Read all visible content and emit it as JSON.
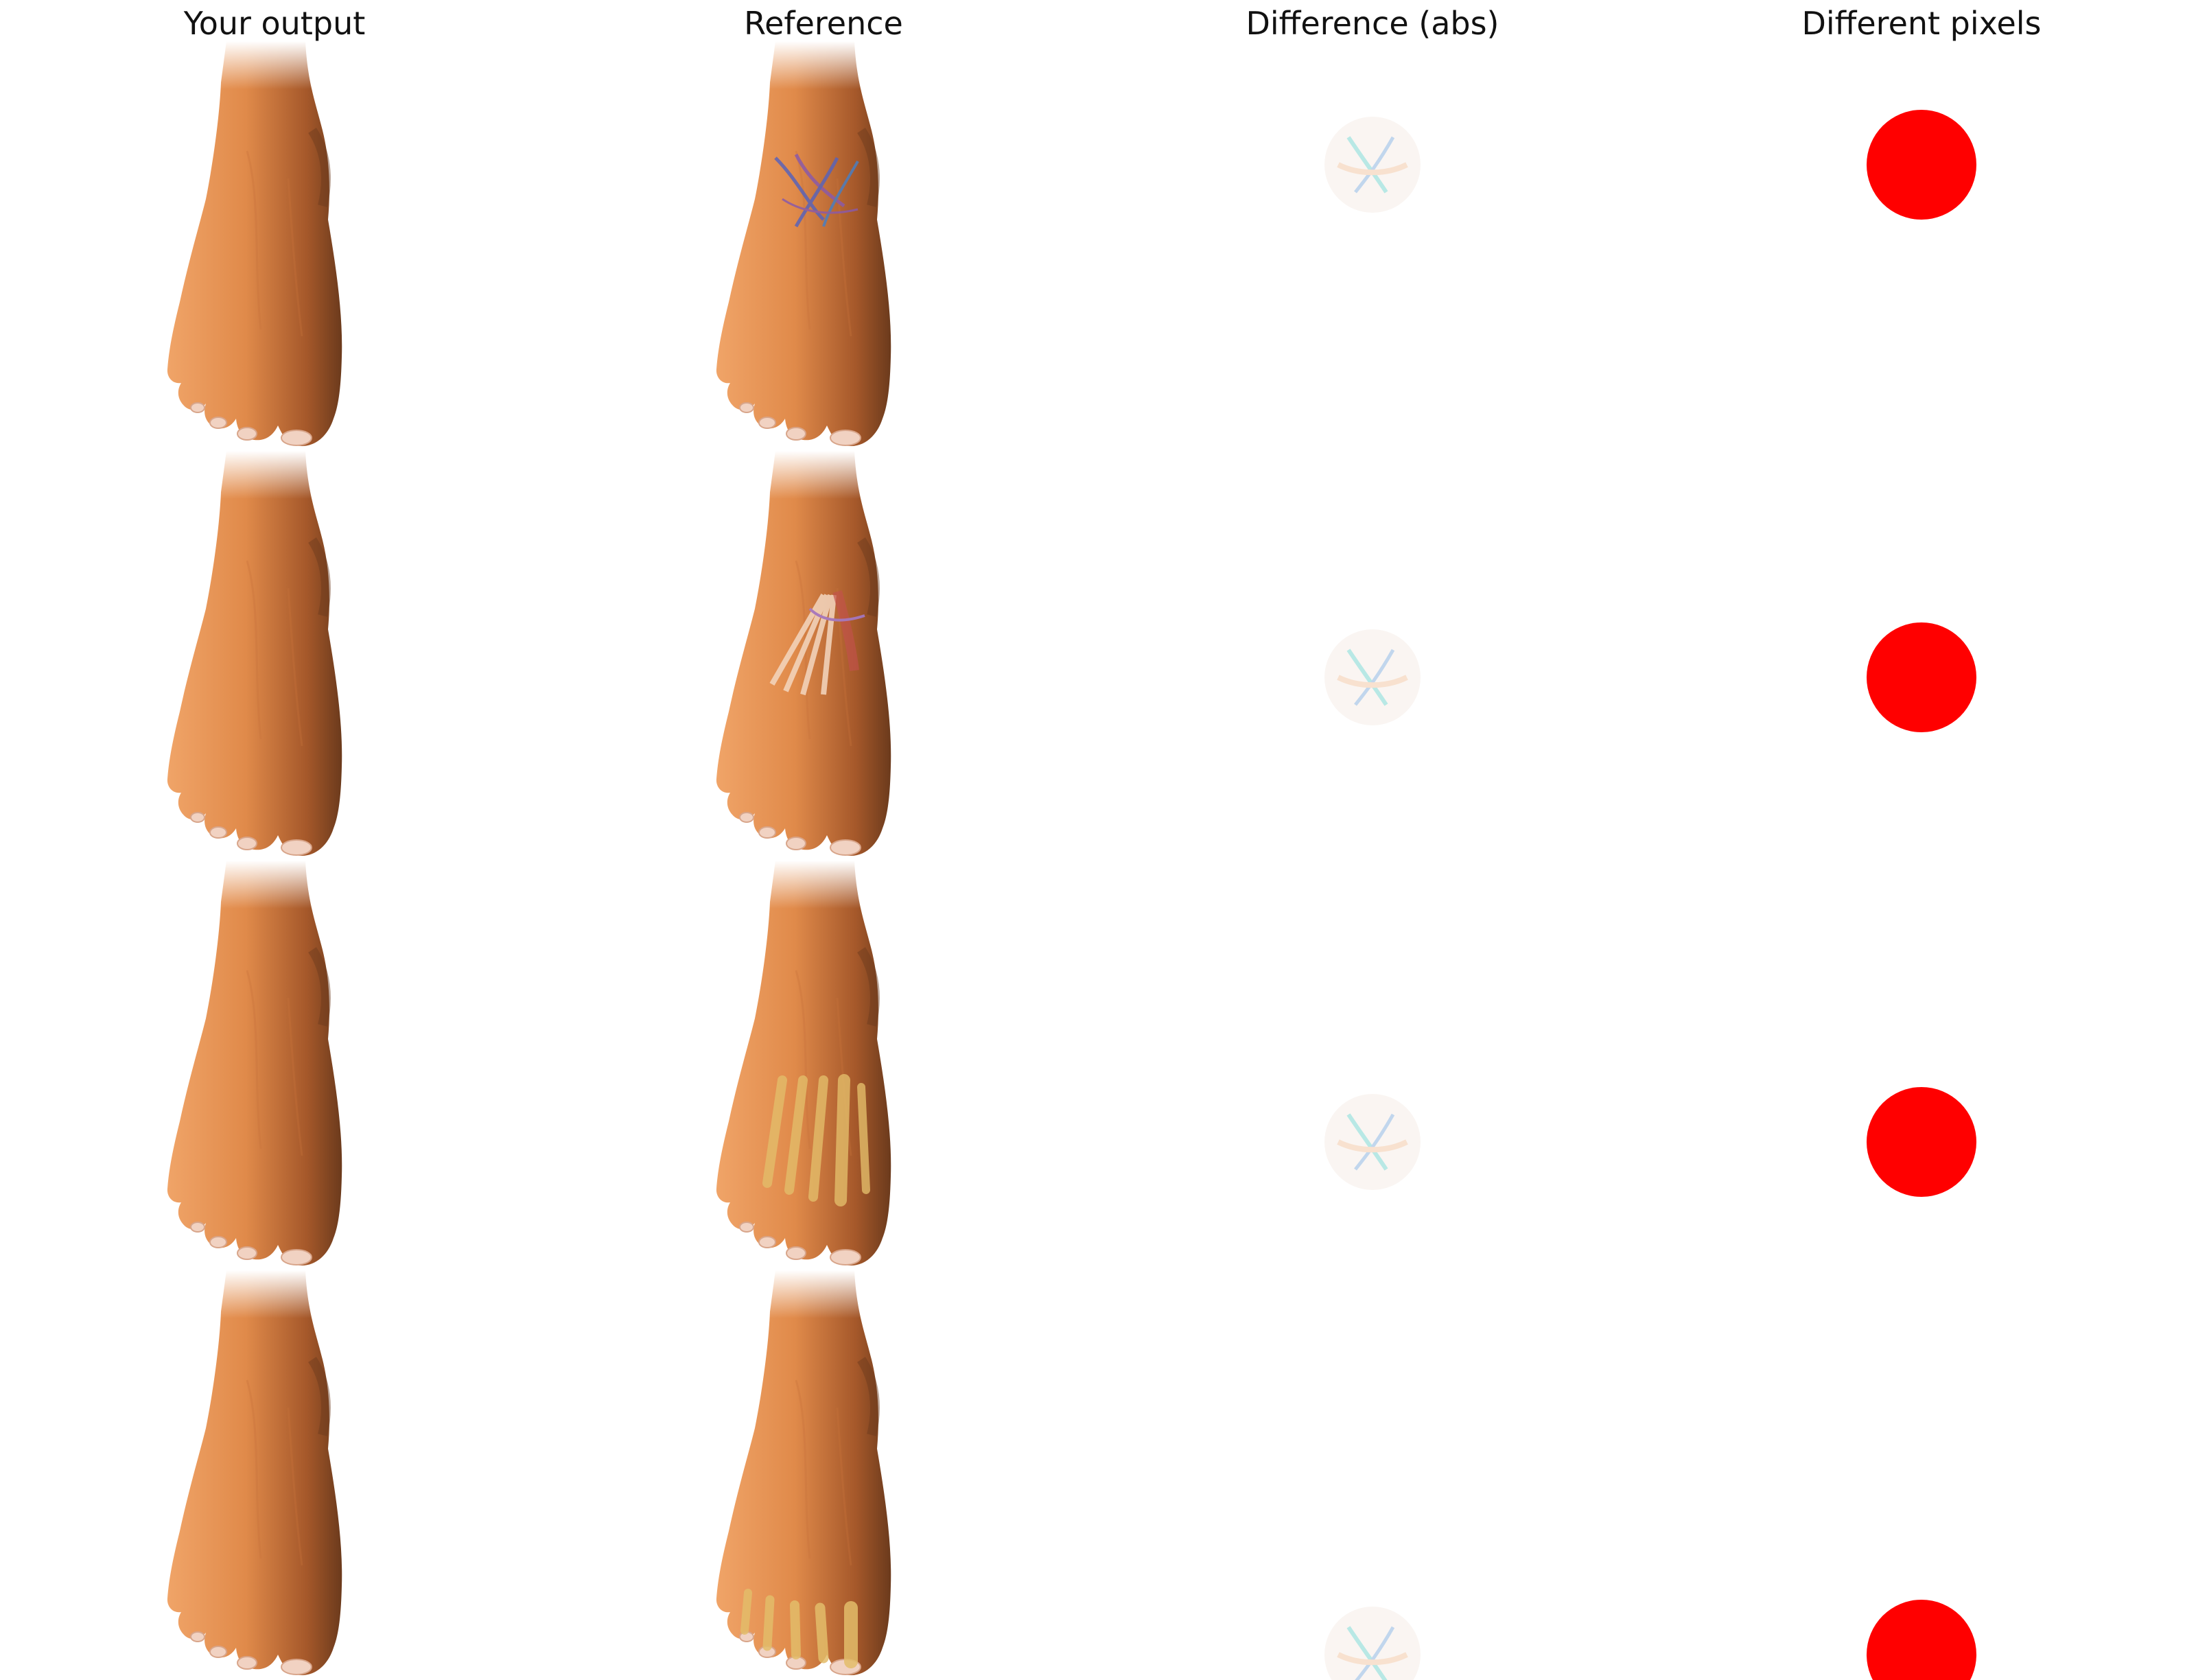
{
  "columns": [
    {
      "id": "output",
      "label": "Your output"
    },
    {
      "id": "reference",
      "label": "Reference"
    },
    {
      "id": "diff",
      "label": "Difference (abs)"
    },
    {
      "id": "mask",
      "label": "Different pixels"
    }
  ],
  "rows": [
    {
      "id": "row-1",
      "overlay": "veins"
    },
    {
      "id": "row-2",
      "overlay": "tendons"
    },
    {
      "id": "row-3",
      "overlay": "metatarsal-bones"
    },
    {
      "id": "row-4",
      "overlay": "toe-bones"
    }
  ],
  "colors": {
    "skin": "#e08a4a",
    "skin_dark": "#a5582a",
    "shadow": "#6b3a1c",
    "nail": "#f1d2c2",
    "vein_blue": "#5a63b8",
    "vein_purple": "#8b5aa8",
    "tendon": "#f4d7c0",
    "muscle": "#c4504e",
    "bone": "#e3bd6a",
    "mask_red": "#ff0000",
    "diff_teal": "#7fd6d0"
  }
}
